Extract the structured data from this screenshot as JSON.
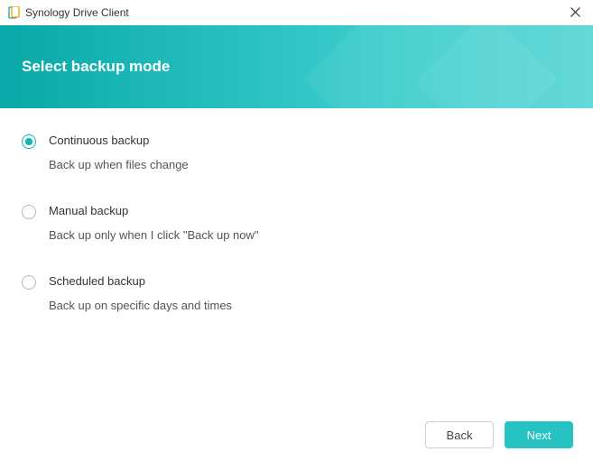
{
  "titlebar": {
    "app_name": "Synology Drive Client"
  },
  "header": {
    "title": "Select backup mode"
  },
  "options": [
    {
      "id": "continuous",
      "label": "Continuous backup",
      "description": "Back up when files change",
      "selected": true
    },
    {
      "id": "manual",
      "label": "Manual backup",
      "description": "Back up only when I click \"Back up now\"",
      "selected": false
    },
    {
      "id": "scheduled",
      "label": "Scheduled backup",
      "description": "Back up on specific days and times",
      "selected": false
    }
  ],
  "footer": {
    "back_label": "Back",
    "next_label": "Next"
  },
  "colors": {
    "accent": "#0fb3b3",
    "header_gradient_start": "#0aa8a8",
    "header_gradient_end": "#5cd6d6",
    "primary_button": "#27c3c3"
  }
}
